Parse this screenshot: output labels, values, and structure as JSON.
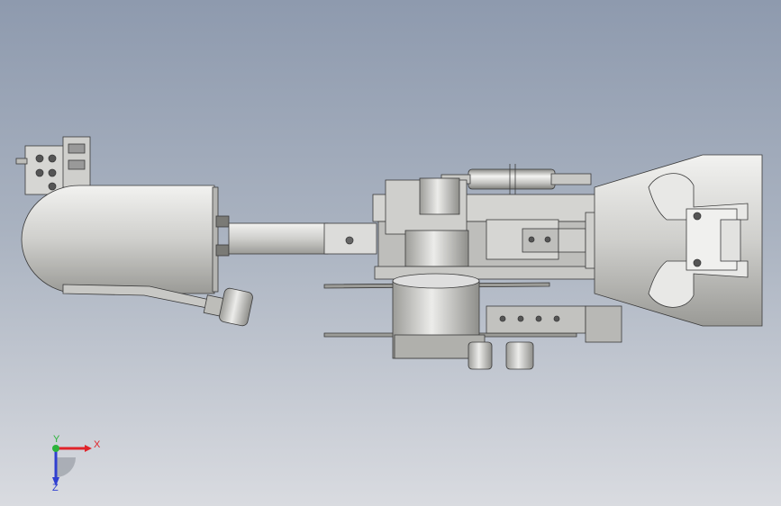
{
  "viewport": {
    "background_top": "#8e9aae",
    "background_bottom": "#d9dbe0"
  },
  "model": {
    "part_fill_light": "#e4e4e2",
    "part_fill_mid": "#c6c6c3",
    "part_fill_dark": "#8f8f8b",
    "edge_color": "#3a3a3a"
  },
  "triad": {
    "x_label": "X",
    "y_label": "Y",
    "z_label": "Z",
    "x_color": "#e0242a",
    "y_color": "#2bb33a",
    "z_color": "#2f3fd0"
  }
}
